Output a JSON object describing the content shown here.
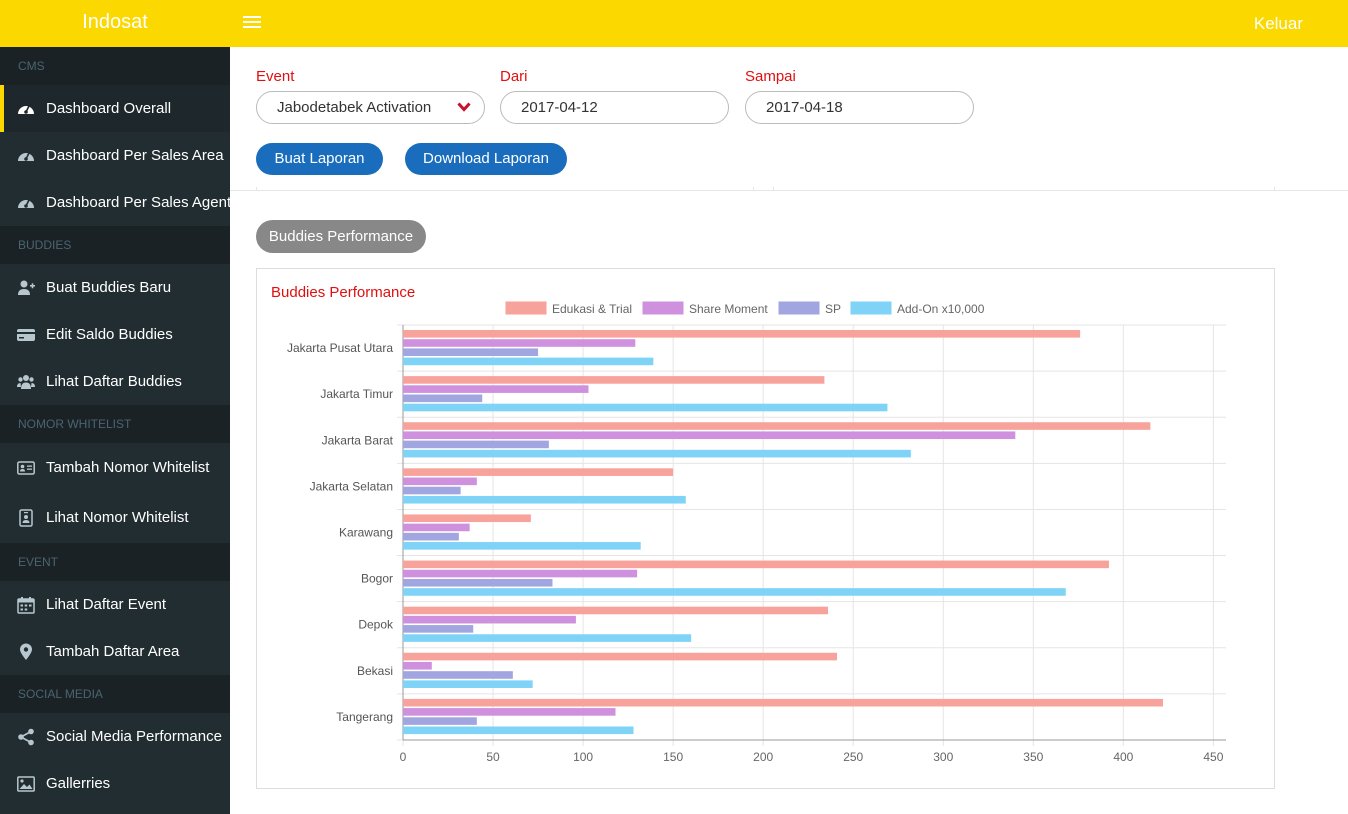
{
  "header": {
    "brand": "Indosat",
    "logout_label": "Keluar",
    "bg_color": "#fad800"
  },
  "sidebar": {
    "sections": [
      {
        "title": "CMS",
        "items": [
          {
            "label": "Dashboard Overall",
            "icon": "dashboard-icon",
            "active": true
          },
          {
            "label": "Dashboard Per Sales Area",
            "icon": "dashboard-icon"
          },
          {
            "label": "Dashboard Per Sales Agent",
            "icon": "dashboard-icon"
          }
        ]
      },
      {
        "title": "BUDDIES",
        "items": [
          {
            "label": "Buat Buddies Baru",
            "icon": "user-plus-icon"
          },
          {
            "label": "Edit Saldo Buddies",
            "icon": "credit-card-icon"
          },
          {
            "label": "Lihat Daftar Buddies",
            "icon": "users-icon"
          }
        ]
      },
      {
        "title": "NOMOR WHITELIST",
        "items": [
          {
            "label": "Tambah Nomor Whitelist",
            "icon": "id-card-icon"
          },
          {
            "label": "Lihat Nomor Whitelist",
            "icon": "id-badge-icon"
          }
        ]
      },
      {
        "title": "EVENT",
        "items": [
          {
            "label": "Lihat Daftar Event",
            "icon": "calendar-icon"
          },
          {
            "label": "Tambah Daftar Area",
            "icon": "map-marker-icon"
          }
        ]
      },
      {
        "title": "SOCIAL MEDIA",
        "items": [
          {
            "label": "Social Media Performance",
            "icon": "share-icon"
          },
          {
            "label": "Gallerries",
            "icon": "image-icon"
          }
        ]
      }
    ]
  },
  "filters": {
    "event_label": "Event",
    "event_value": "Jabodetabek Activation",
    "from_label": "Dari",
    "from_value": "2017-04-12",
    "to_label": "Sampai",
    "to_value": "2017-04-18"
  },
  "actions": {
    "create_label": "Buat Laporan",
    "download_label": "Download Laporan"
  },
  "tab_label": "Buddies Performance",
  "chart_data": {
    "type": "bar",
    "orientation": "horizontal",
    "title": "Buddies Performance",
    "categories": [
      "Jakarta Pusat Utara",
      "Jakarta Timur",
      "Jakarta Barat",
      "Jakarta Selatan",
      "Karawang",
      "Bogor",
      "Depok",
      "Bekasi",
      "Tangerang"
    ],
    "series": [
      {
        "name": "Edukasi & Trial",
        "color": "#f7a29a",
        "values": [
          376,
          234,
          415,
          150,
          71,
          392,
          236,
          241,
          422
        ]
      },
      {
        "name": "Share Moment",
        "color": "#cf90dd",
        "values": [
          129,
          103,
          340,
          41,
          37,
          130,
          96,
          16,
          118
        ]
      },
      {
        "name": "SP",
        "color": "#a1a6e0",
        "values": [
          75,
          44,
          81,
          32,
          31,
          83,
          39,
          61,
          41
        ]
      },
      {
        "name": "Add-On x10,000",
        "color": "#7fd3f7",
        "values": [
          139,
          269,
          282,
          157,
          132,
          368,
          160,
          72,
          128
        ]
      }
    ],
    "xticks": [
      0,
      50,
      100,
      150,
      200,
      250,
      300,
      350,
      400,
      450
    ],
    "xlim": [
      0,
      457
    ],
    "grid": true,
    "legend": "top"
  }
}
